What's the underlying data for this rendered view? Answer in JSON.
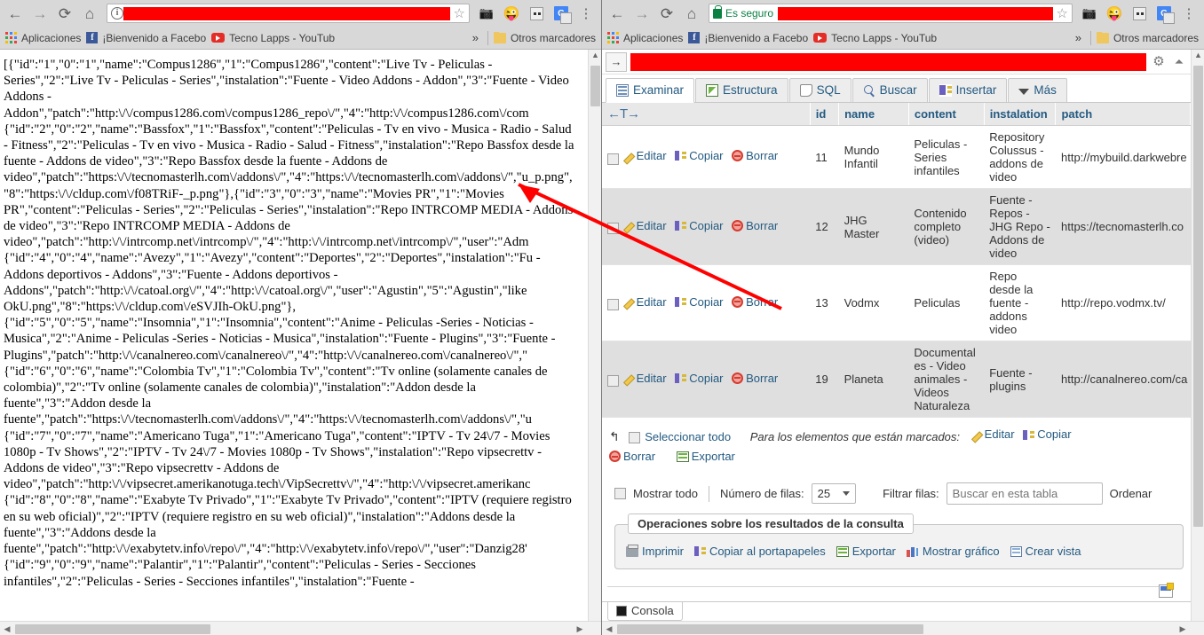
{
  "left_browser": {
    "nav": {
      "back": "←",
      "forward": "→",
      "reload": "⟳",
      "home": "⌂"
    },
    "omnibox": {
      "security_icon": "info-icon",
      "url_redacted": true,
      "bookmark_icon": "star-icon"
    },
    "toolbar_icons": [
      "camera-icon",
      "emoji-icon",
      "outlet-icon",
      "google-translate-icon",
      "chrome-menu-icon"
    ],
    "bookmarks": [
      {
        "icon": "apps-grid-icon",
        "label": "Aplicaciones"
      },
      {
        "icon": "facebook-icon",
        "label": "¡Bienvenido a Facebo"
      },
      {
        "icon": "youtube-icon",
        "label": "Tecno Lapps - YouTub"
      }
    ],
    "overflow": "»",
    "other_bookmarks": {
      "icon": "folder-icon",
      "label": "Otros marcadores"
    }
  },
  "right_browser": {
    "nav": {
      "back": "←",
      "forward": "→",
      "reload": "⟳",
      "home": "⌂"
    },
    "omnibox": {
      "security_icon": "lock-icon",
      "security_text": "Es seguro",
      "url_redacted": true,
      "bookmark_icon": "star-icon"
    },
    "toolbar_icons": [
      "camera-icon",
      "emoji-icon",
      "outlet-icon",
      "google-translate-icon",
      "chrome-menu-icon"
    ],
    "bookmarks": [
      {
        "icon": "apps-grid-icon",
        "label": "Aplicaciones"
      },
      {
        "icon": "facebook-icon",
        "label": "¡Bienvenido a Facebo"
      },
      {
        "icon": "youtube-icon",
        "label": "Tecno Lapps - YouTub"
      }
    ],
    "overflow": "»",
    "other_bookmarks": {
      "icon": "folder-icon",
      "label": "Otros marcadores"
    }
  },
  "json_dump": {
    "text": "[{\"id\":\"1\",\"0\":\"1\",\"name\":\"Compus1286\",\"1\":\"Compus1286\",\"content\":\"Live Tv - Peliculas - Series\",\"2\":\"Live Tv - Peliculas - Series\",\"instalation\":\"Fuente - Video Addons - Addon\",\"3\":\"Fuente - Video Addons - Addon\",\"patch\":\"http:\\/\\/compus1286.com\\/compus1286_repo\\/\",\"4\":\"http:\\/\\/compus1286.com\\/com\n{\"id\":\"2\",\"0\":\"2\",\"name\":\"Bassfox\",\"1\":\"Bassfox\",\"content\":\"Peliculas - Tv en vivo - Musica - Radio - Salud - Fitness\",\"2\":\"Peliculas - Tv en vivo - Musica - Radio - Salud - Fitness\",\"instalation\":\"Repo Bassfox desde la fuente - Addons de video\",\"3\":\"Repo Bassfox desde la fuente - Addons de video\",\"patch\":\"https:\\/\\/tecnomasterlh.com\\/addons\\/\",\"4\":\"https:\\/\\/tecnomasterlh.com\\/addons\\/\",\"u_p.png\",\"8\":\"https:\\/\\/cldup.com\\/f08TRiF-_p.png\"},{\"id\":\"3\",\"0\":\"3\",\"name\":\"Movies PR\",\"1\":\"Movies PR\",\"content\":\"Peliculas - Series\",\"2\":\"Peliculas - Series\",\"instalation\":\"Repo INTRCOMP MEDIA - Addons de video\",\"3\":\"Repo INTRCOMP MEDIA - Addons de video\",\"patch\":\"http:\\/\\/intrcomp.net\\/intrcomp\\/\",\"4\":\"http:\\/\\/intrcomp.net\\/intrcomp\\/\",\"user\":\"Adm\n{\"id\":\"4\",\"0\":\"4\",\"name\":\"Avezy\",\"1\":\"Avezy\",\"content\":\"Deportes\",\"2\":\"Deportes\",\"instalation\":\"Fu - Addons deportivos - Addons\",\"3\":\"Fuente - Addons deportivos - Addons\",\"patch\":\"http:\\/\\/catoal.org\\/\",\"4\":\"http:\\/\\/catoal.org\\/\",\"user\":\"Agustin\",\"5\":\"Agustin\",\"like\nOkU.png\",\"8\":\"https:\\/\\/cldup.com\\/eSVJIh-OkU.png\"},\n{\"id\":\"5\",\"0\":\"5\",\"name\":\"Insomnia\",\"1\":\"Insomnia\",\"content\":\"Anime - Peliculas -Series - Noticias - Musica\",\"2\":\"Anime - Peliculas -Series - Noticias - Musica\",\"instalation\":\"Fuente - Plugins\",\"3\":\"Fuente - Plugins\",\"patch\":\"http:\\/\\/canalnereo.com\\/canalnereo\\/\",\"4\":\"http:\\/\\/canalnereo.com\\/canalnereo\\/\",\"\n{\"id\":\"6\",\"0\":\"6\",\"name\":\"Colombia Tv\",\"1\":\"Colombia Tv\",\"content\":\"Tv online (solamente canales de colombia)\",\"2\":\"Tv online (solamente canales de colombia)\",\"instalation\":\"Addon desde la fuente\",\"3\":\"Addon desde la fuente\",\"patch\":\"https:\\/\\/tecnomasterlh.com\\/addons\\/\",\"4\":\"https:\\/\\/tecnomasterlh.com\\/addons\\/\",\"u\n{\"id\":\"7\",\"0\":\"7\",\"name\":\"Americano Tuga\",\"1\":\"Americano Tuga\",\"content\":\"IPTV - Tv 24\\/7 - Movies 1080p - Tv Shows\",\"2\":\"IPTV - Tv 24\\/7 - Movies 1080p - Tv Shows\",\"instalation\":\"Repo vipsecrettv - Addons de video\",\"3\":\"Repo vipsecrettv - Addons de video\",\"patch\":\"http:\\/\\/vipsecret.amerikanotuga.tech\\/VipSecrettv\\/\",\"4\":\"http:\\/\\/vipsecret.amerikanc\n{\"id\":\"8\",\"0\":\"8\",\"name\":\"Exabyte Tv Privado\",\"1\":\"Exabyte Tv Privado\",\"content\":\"IPTV (requiere registro en su web oficial)\",\"2\":\"IPTV (requiere registro en su web oficial)\",\"instalation\":\"Addons desde la fuente\",\"3\":\"Addons desde la fuente\",\"patch\":\"http:\\/\\/exabytetv.info\\/repo\\/\",\"4\":\"http:\\/\\/exabytetv.info\\/repo\\/\",\"user\":\"Danzig28'\n{\"id\":\"9\",\"0\":\"9\",\"name\":\"Palantir\",\"1\":\"Palantir\",\"content\":\"Peliculas - Series - Secciones infantiles\",\"2\":\"Peliculas - Series - Secciones infantiles\",\"instalation\":\"Fuente - "
  },
  "phpmyadmin": {
    "topbar": {
      "go_label": "→",
      "query_redacted": true,
      "gear_icon": "gear-icon",
      "collapse_icon": "collapse-icon"
    },
    "tabs": [
      {
        "label": "Examinar",
        "icon": "browse-icon",
        "active": true
      },
      {
        "label": "Estructura",
        "icon": "structure-icon",
        "active": false
      },
      {
        "label": "SQL",
        "icon": "sql-icon",
        "active": false
      },
      {
        "label": "Buscar",
        "icon": "search-icon",
        "active": false
      },
      {
        "label": "Insertar",
        "icon": "insert-icon",
        "active": false
      },
      {
        "label": "Más",
        "icon": "more-caret-icon",
        "active": false
      }
    ],
    "table": {
      "sort_header": "←T→",
      "columns": [
        "id",
        "name",
        "content",
        "instalation",
        "patch"
      ],
      "row_actions": {
        "edit": "Editar",
        "copy": "Copiar",
        "delete": "Borrar"
      },
      "rows": [
        {
          "id": "11",
          "name": "Mundo Infantil",
          "content": "Peliculas - Series infantiles",
          "instalation": "Repository Colussus - addons de video",
          "patch": "http://mybuild.darkwebre"
        },
        {
          "id": "12",
          "name": "JHG Master",
          "content": "Contenido completo (video)",
          "instalation": "Fuente - Repos - JHG Repo - Addons de video",
          "patch": "https://tecnomasterlh.co"
        },
        {
          "id": "13",
          "name": "Vodmx",
          "content": "Peliculas",
          "instalation": "Repo desde la fuente - addons video",
          "patch": "http://repo.vodmx.tv/"
        },
        {
          "id": "19",
          "name": "Planeta",
          "content": "Documentales - Video animales - Videos Naturaleza",
          "instalation": "Fuente - plugins",
          "patch": "http://canalnereo.com/ca"
        }
      ]
    },
    "bulk_actions": {
      "select_all": "Seleccionar todo",
      "prompt": "Para los elementos que están marcados:",
      "edit": "Editar",
      "copy": "Copiar",
      "delete": "Borrar",
      "export": "Exportar"
    },
    "rows_bar": {
      "show_all": "Mostrar todo",
      "rows_label": "Número de filas:",
      "rows_value": "25",
      "filter_label": "Filtrar filas:",
      "filter_placeholder": "Buscar en esta tabla",
      "sort_label": "Ordenar"
    },
    "query_ops": {
      "legend": "Operaciones sobre los resultados de la consulta",
      "links": [
        {
          "label": "Imprimir",
          "icon": "print-icon"
        },
        {
          "label": "Copiar al portapapeles",
          "icon": "copy-icon"
        },
        {
          "label": "Exportar",
          "icon": "export-icon"
        },
        {
          "label": "Mostrar gráfico",
          "icon": "chart-icon"
        },
        {
          "label": "Crear vista",
          "icon": "create-view-icon"
        }
      ]
    },
    "console": {
      "label": "Consola",
      "icon": "console-icon"
    }
  },
  "annotation": {
    "type": "red-arrow",
    "color": "#ff0000",
    "from": [
      580,
      208
    ],
    "to": [
      880,
      348
    ]
  }
}
